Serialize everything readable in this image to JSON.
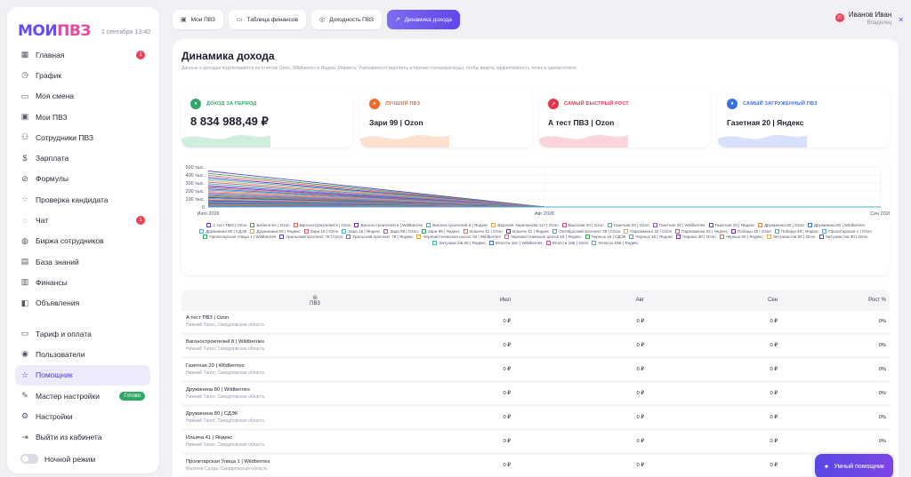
{
  "brand": {
    "logo_a": "МОИ",
    "logo_b": "ПВЗ",
    "date": "1 сентября 13:40"
  },
  "sidebar": {
    "items": [
      {
        "label": "Главная",
        "icon": "grid-icon",
        "glyph": "▦",
        "badge": "1"
      },
      {
        "label": "График",
        "icon": "clock-icon",
        "glyph": "◷"
      },
      {
        "label": "Моя смена",
        "icon": "card-icon",
        "glyph": "▭"
      },
      {
        "label": "Мои ПВЗ",
        "icon": "box-icon",
        "glyph": "▣"
      },
      {
        "label": "Сотрудники ПВЗ",
        "icon": "users-icon",
        "glyph": "⚇"
      },
      {
        "label": "Зарплата",
        "icon": "dollar-icon",
        "glyph": "$"
      },
      {
        "label": "Формулы",
        "icon": "formula-icon",
        "glyph": "⊘"
      },
      {
        "label": "Проверка кандидата",
        "icon": "check-person-icon",
        "glyph": "⁘"
      },
      {
        "label": "Чат",
        "icon": "chat-icon",
        "glyph": "◌",
        "badge": "1"
      },
      {
        "label": "Биржа сотрудников",
        "icon": "exchange-icon",
        "glyph": "◍"
      },
      {
        "label": "База знаний",
        "icon": "book-icon",
        "glyph": "▤"
      },
      {
        "label": "Финансы",
        "icon": "finance-icon",
        "glyph": "▥"
      },
      {
        "label": "Объявления",
        "icon": "megaphone-icon",
        "glyph": "◧"
      }
    ],
    "bottom_items": [
      {
        "label": "Тариф и оплата",
        "icon": "wallet-icon",
        "glyph": "▭"
      },
      {
        "label": "Пользователи",
        "icon": "user-icon",
        "glyph": "◉"
      },
      {
        "label": "Помощник",
        "icon": "star-icon",
        "glyph": "☆",
        "active": true
      },
      {
        "label": "Мастер настройки",
        "icon": "wand-icon",
        "glyph": "✎",
        "tag": "Готово"
      },
      {
        "label": "Настройки",
        "icon": "gear-icon",
        "glyph": "⚙"
      },
      {
        "label": "Выйти из кабинета",
        "icon": "logout-icon",
        "glyph": "⇥"
      }
    ],
    "night_mode": "Ночной режим"
  },
  "tabs": [
    {
      "label": "Мои ПВЗ",
      "icon": "box-icon",
      "glyph": "▣"
    },
    {
      "label": "Таблица финансов",
      "icon": "table-icon",
      "glyph": "▭"
    },
    {
      "label": "Доходность ПВЗ",
      "icon": "coin-icon",
      "glyph": "◎"
    },
    {
      "label": "Динамика дохода",
      "icon": "trend-icon",
      "glyph": "↗",
      "active": true
    }
  ],
  "user": {
    "name": "Иванов Иван",
    "role": "Владелец",
    "notifications": "31"
  },
  "page": {
    "title": "Динамика дохода",
    "description": "Данные о доходах подтягиваются из отчётов Ozon, Wildberries и Яндекс Маркета. Учитываются зарплаты и прочие статьи/расходы, чтобы видеть эффективность точек в одном отчёте."
  },
  "kpis": [
    {
      "label": "ДОХОД ЗА ПЕРИОД",
      "value": "8 834 988,49 ₽",
      "color": "#2fa866",
      "wave": "#cfeedb",
      "glyph": "●",
      "icon": "income-icon"
    },
    {
      "label": "ЛУЧШИЙ ПВЗ",
      "value": "Зари 99 | Ozon",
      "color": "#f06a2a",
      "wave": "#fde0d0",
      "glyph": "♦",
      "icon": "trophy-icon"
    },
    {
      "label": "САМЫЙ БЫСТРЫЙ РОСТ",
      "value": "А тест ПВЗ | Ozon",
      "color": "#e8344d",
      "wave": "#fbd3da",
      "glyph": "↗",
      "icon": "growth-icon"
    },
    {
      "label": "САМЫЙ ЗАГРУЖЕННЫЙ ПВЗ",
      "value": "Газетная 20 | Яндекс",
      "color": "#3b6fe0",
      "wave": "#d7e1fb",
      "glyph": "♦",
      "icon": "load-icon"
    }
  ],
  "chart_data": {
    "type": "line",
    "categories": [
      "Июл 2026",
      "Авг 2026",
      "Сен 2026"
    ],
    "y_ticks": [
      "500 тыс.",
      "400 тыс.",
      "300 тыс.",
      "200 тыс.",
      "100 тыс.",
      "0"
    ],
    "ylim": [
      0,
      500000
    ],
    "grid": true,
    "legend": "bottom",
    "series": [
      {
        "name": "А тест ПВЗ | Ozon",
        "color": "#5b3fd6",
        "values": [
          450000,
          0,
          0
        ]
      },
      {
        "name": "Бебеля 6А | Ozon",
        "color": "#3aa655",
        "values": [
          420000,
          0,
          0
        ]
      },
      {
        "name": "Вагоностроителей 8 | Ozon",
        "color": "#e86a5a",
        "values": [
          395000,
          0,
          0
        ]
      },
      {
        "name": "Вагоностроителей 8 | Wildberries",
        "color": "#6c2fc9",
        "values": [
          370000,
          0,
          0
        ]
      },
      {
        "name": "Вагоностроителей 8 | Яндекс",
        "color": "#2ab8c7",
        "values": [
          350000,
          0,
          0
        ]
      },
      {
        "name": "Верхняя Черепанова 117 | Ozon",
        "color": "#e0b35a",
        "values": [
          330000,
          0,
          0
        ]
      },
      {
        "name": "Вьюсная 20 | Ozon",
        "color": "#d94f8a",
        "values": [
          310000,
          0,
          0
        ]
      },
      {
        "name": "Газетная 20 | Ozon",
        "color": "#3fb7a6",
        "values": [
          290000,
          0,
          0
        ]
      },
      {
        "name": "Газетная 20 | Wildberries",
        "color": "#8a5ad6",
        "values": [
          270000,
          0,
          0
        ]
      },
      {
        "name": "Газетная 20 | Яндекс",
        "color": "#5b3fd6",
        "values": [
          255000,
          0,
          0
        ]
      },
      {
        "name": "Дружинина 80 | Ozon",
        "color": "#e0834a",
        "values": [
          240000,
          0,
          0
        ]
      },
      {
        "name": "Дружинина 80 | Wildberries",
        "color": "#3b6fe0",
        "values": [
          225000,
          0,
          0
        ]
      },
      {
        "name": "Дружинина 80 | СДЭК",
        "color": "#5aa0d8",
        "values": [
          210000,
          0,
          0
        ]
      },
      {
        "name": "Дружинина 80 | Яндекс",
        "color": "#f0a03a",
        "values": [
          195000,
          0,
          0
        ]
      },
      {
        "name": "Зари 16 | Ozon",
        "color": "#ef5a7a",
        "values": [
          180000,
          0,
          0
        ]
      },
      {
        "name": "Зари 16 | Яндекс",
        "color": "#4ab0d8",
        "values": [
          168000,
          0,
          0
        ]
      },
      {
        "name": "Зари 99 | Ozon",
        "color": "#a45ad6",
        "values": [
          155000,
          0,
          0
        ]
      },
      {
        "name": "Зари 99 | Яндекс",
        "color": "#3aa655",
        "values": [
          142000,
          0,
          0
        ]
      },
      {
        "name": "Ильича 41 | Ozon",
        "color": "#e86a5a",
        "values": [
          130000,
          0,
          0
        ]
      },
      {
        "name": "Ильича 41 | Яндекс",
        "color": "#3f3fb0",
        "values": [
          118000,
          0,
          0
        ]
      },
      {
        "name": "Октябрьский проспект 28 | Ozon",
        "color": "#2ab8c7",
        "values": [
          106000,
          0,
          0
        ]
      },
      {
        "name": "Пархоменко 24 | Ozon",
        "color": "#e0b35a",
        "values": [
          95000,
          0,
          0
        ]
      },
      {
        "name": "Пархоменко 24 | Яндекс",
        "color": "#d94f8a",
        "values": [
          85000,
          0,
          0
        ]
      },
      {
        "name": "Победы 48 | Ozon",
        "color": "#6c2fc9",
        "values": [
          75000,
          0,
          0
        ]
      },
      {
        "name": "Победы 48 | Яндекс",
        "color": "#3fb7a6",
        "values": [
          66000,
          0,
          0
        ]
      },
      {
        "name": "Пролетарская 1 | Ozon",
        "color": "#5aa0d8",
        "values": [
          58000,
          0,
          0
        ]
      },
      {
        "name": "Пролетарская Улица 1 | Wildberries",
        "color": "#3aa655",
        "values": [
          50000,
          0,
          0
        ]
      },
      {
        "name": "Уральский проспект 78 | Ozon",
        "color": "#5b3fd6",
        "values": [
          43000,
          0,
          0
        ]
      },
      {
        "name": "Уральский проспект 78 | Яндекс",
        "color": "#8a5ad6",
        "values": [
          37000,
          0,
          0
        ]
      },
      {
        "name": "Черноисточинское шоссе 18 | Wildberries",
        "color": "#f0a03a",
        "values": [
          31000,
          0,
          0
        ]
      },
      {
        "name": "Черноисточинское шоссе 18 | Яндекс",
        "color": "#ef5a7a",
        "values": [
          26000,
          0,
          0
        ]
      },
      {
        "name": "Черных 18 | СДЭК",
        "color": "#3aa655",
        "values": [
          21000,
          0,
          0
        ]
      },
      {
        "name": "Черных 18 | Яндекс",
        "color": "#2ab8c7",
        "values": [
          17000,
          0,
          0
        ]
      },
      {
        "name": "Черных 30 | Ozon",
        "color": "#6c2fc9",
        "values": [
          13000,
          0,
          0
        ]
      },
      {
        "name": "Черных 30 | Яндекс",
        "color": "#e86a5a",
        "values": [
          10000,
          0,
          0
        ]
      },
      {
        "name": "Энтузиастов 50 | Ozon",
        "color": "#e0b35a",
        "values": [
          8000,
          0,
          0
        ]
      },
      {
        "name": "Энтузиастов 30 | Ozon",
        "color": "#5b3fd6",
        "values": [
          6000,
          0,
          0
        ]
      },
      {
        "name": "Энтузиастов 30 | Яндекс",
        "color": "#3fb7a6",
        "values": [
          4000,
          0,
          0
        ]
      },
      {
        "name": "Юности 16А | Wildberries",
        "color": "#3b6fe0",
        "values": [
          3000,
          0,
          0
        ]
      },
      {
        "name": "Юности 18Б | Ozon",
        "color": "#d94f8a",
        "values": [
          2000,
          0,
          0
        ]
      },
      {
        "name": "Юности 18Б | Яндекс",
        "color": "#4ab0d8",
        "values": [
          1000,
          0,
          0
        ]
      }
    ]
  },
  "table": {
    "head": {
      "name": "ПВЗ",
      "name_icon": "sort-icon",
      "name_glyph": "⊜",
      "cols": [
        "Июл",
        "Авг",
        "Сен",
        "Рост %"
      ]
    },
    "rows": [
      {
        "name": "А тест ПВЗ | Ozon",
        "location": "Нижний Тагил, Свердловская область",
        "values": [
          "0 ₽",
          "0 ₽",
          "0 ₽",
          "0%"
        ]
      },
      {
        "name": "Вагоностроителей 8 | Wildberries",
        "location": "Нижний Тагил, Свердловская область",
        "values": [
          "0 ₽",
          "0 ₽",
          "0 ₽",
          "0%"
        ]
      },
      {
        "name": "Газетная 20 | Wildberries",
        "location": "Нижний Тагил, Свердловская область",
        "values": [
          "0 ₽",
          "0 ₽",
          "0 ₽",
          "0%"
        ]
      },
      {
        "name": "Дружинина 80 | Wildberries",
        "location": "Нижний Тагил, Свердловская область",
        "values": [
          "0 ₽",
          "0 ₽",
          "0 ₽",
          "0%"
        ]
      },
      {
        "name": "Дружинина 80 | СДЭК",
        "location": "Нижний Тагил, Свердловская область",
        "values": [
          "0 ₽",
          "0 ₽",
          "0 ₽",
          "0%"
        ]
      },
      {
        "name": "Ильича 41 | Яндекс",
        "location": "Нижний Тагил, Свердловская область",
        "values": [
          "0 ₽",
          "0 ₽",
          "0 ₽",
          "0%"
        ]
      },
      {
        "name": "Пролетарская Улица 1 | Wildberries",
        "location": "Верхняя Салда, Свердловская область",
        "values": [
          "0 ₽",
          "0 ₽",
          "0 ₽",
          "0%"
        ]
      }
    ]
  },
  "assistant": {
    "label": "Умный помощник",
    "icon": "sparkle-icon",
    "glyph": "✦"
  },
  "colors": {
    "accent": "#6146e8",
    "badge": "#ef3f56",
    "success": "#2fa866"
  }
}
